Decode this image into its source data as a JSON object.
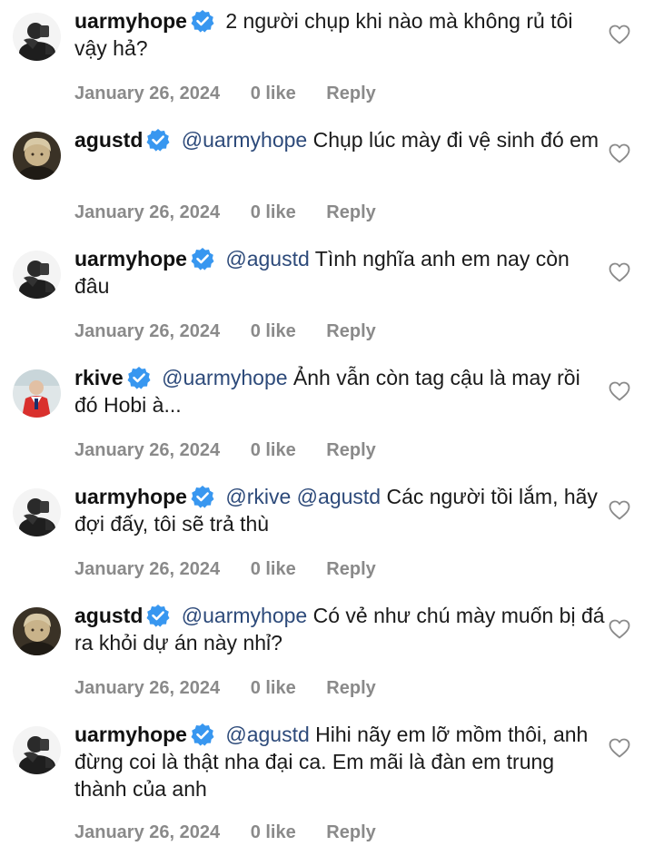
{
  "colors": {
    "mention": "#2d4a7a",
    "verified": "#3897f0",
    "meta": "#8a8a8a"
  },
  "comments": [
    {
      "username": "uarmyhope",
      "mention": "",
      "text": "2 người chụp khi nào mà không rủ tôi vậy hả?",
      "date": "January 26, 2024",
      "likes": "0 like",
      "reply": "Reply",
      "avatar": "uarmyhope-avatar"
    },
    {
      "username": "agustd",
      "mention": "@uarmyhope",
      "text": "Chụp lúc mày đi vệ sinh đó em",
      "date": "January 26, 2024",
      "likes": "0 like",
      "reply": "Reply",
      "avatar": "agustd-avatar"
    },
    {
      "username": "uarmyhope",
      "mention": "@agustd",
      "text": "Tình nghĩa anh em nay còn đâu",
      "date": "January 26, 2024",
      "likes": "0 like",
      "reply": "Reply",
      "avatar": "uarmyhope-avatar"
    },
    {
      "username": "rkive",
      "mention": "@uarmyhope",
      "text": "Ảnh vẫn còn tag cậu là may rồi đó Hobi à...",
      "date": "January 26, 2024",
      "likes": "0 like",
      "reply": "Reply",
      "avatar": "rkive-avatar"
    },
    {
      "username": "uarmyhope",
      "mention": "@rkive @agustd",
      "text": "Các người tồi lắm, hãy đợi đấy, tôi sẽ trả thù",
      "date": "January 26, 2024",
      "likes": "0 like",
      "reply": "Reply",
      "avatar": "uarmyhope-avatar"
    },
    {
      "username": "agustd",
      "mention": "@uarmyhope",
      "text": "Có vẻ như chú mày muốn bị đá ra khỏi dự án này nhỉ?",
      "date": "January 26, 2024",
      "likes": "0 like",
      "reply": "Reply",
      "avatar": "agustd-avatar"
    },
    {
      "username": "uarmyhope",
      "mention": "@agustd",
      "text": "Hihi nãy em lỡ mồm thôi, anh đừng coi là thật nha đại ca. Em mãi là đàn em trung thành của anh",
      "date": "January 26, 2024",
      "likes": "0 like",
      "reply": "Reply",
      "avatar": "uarmyhope-avatar"
    }
  ]
}
